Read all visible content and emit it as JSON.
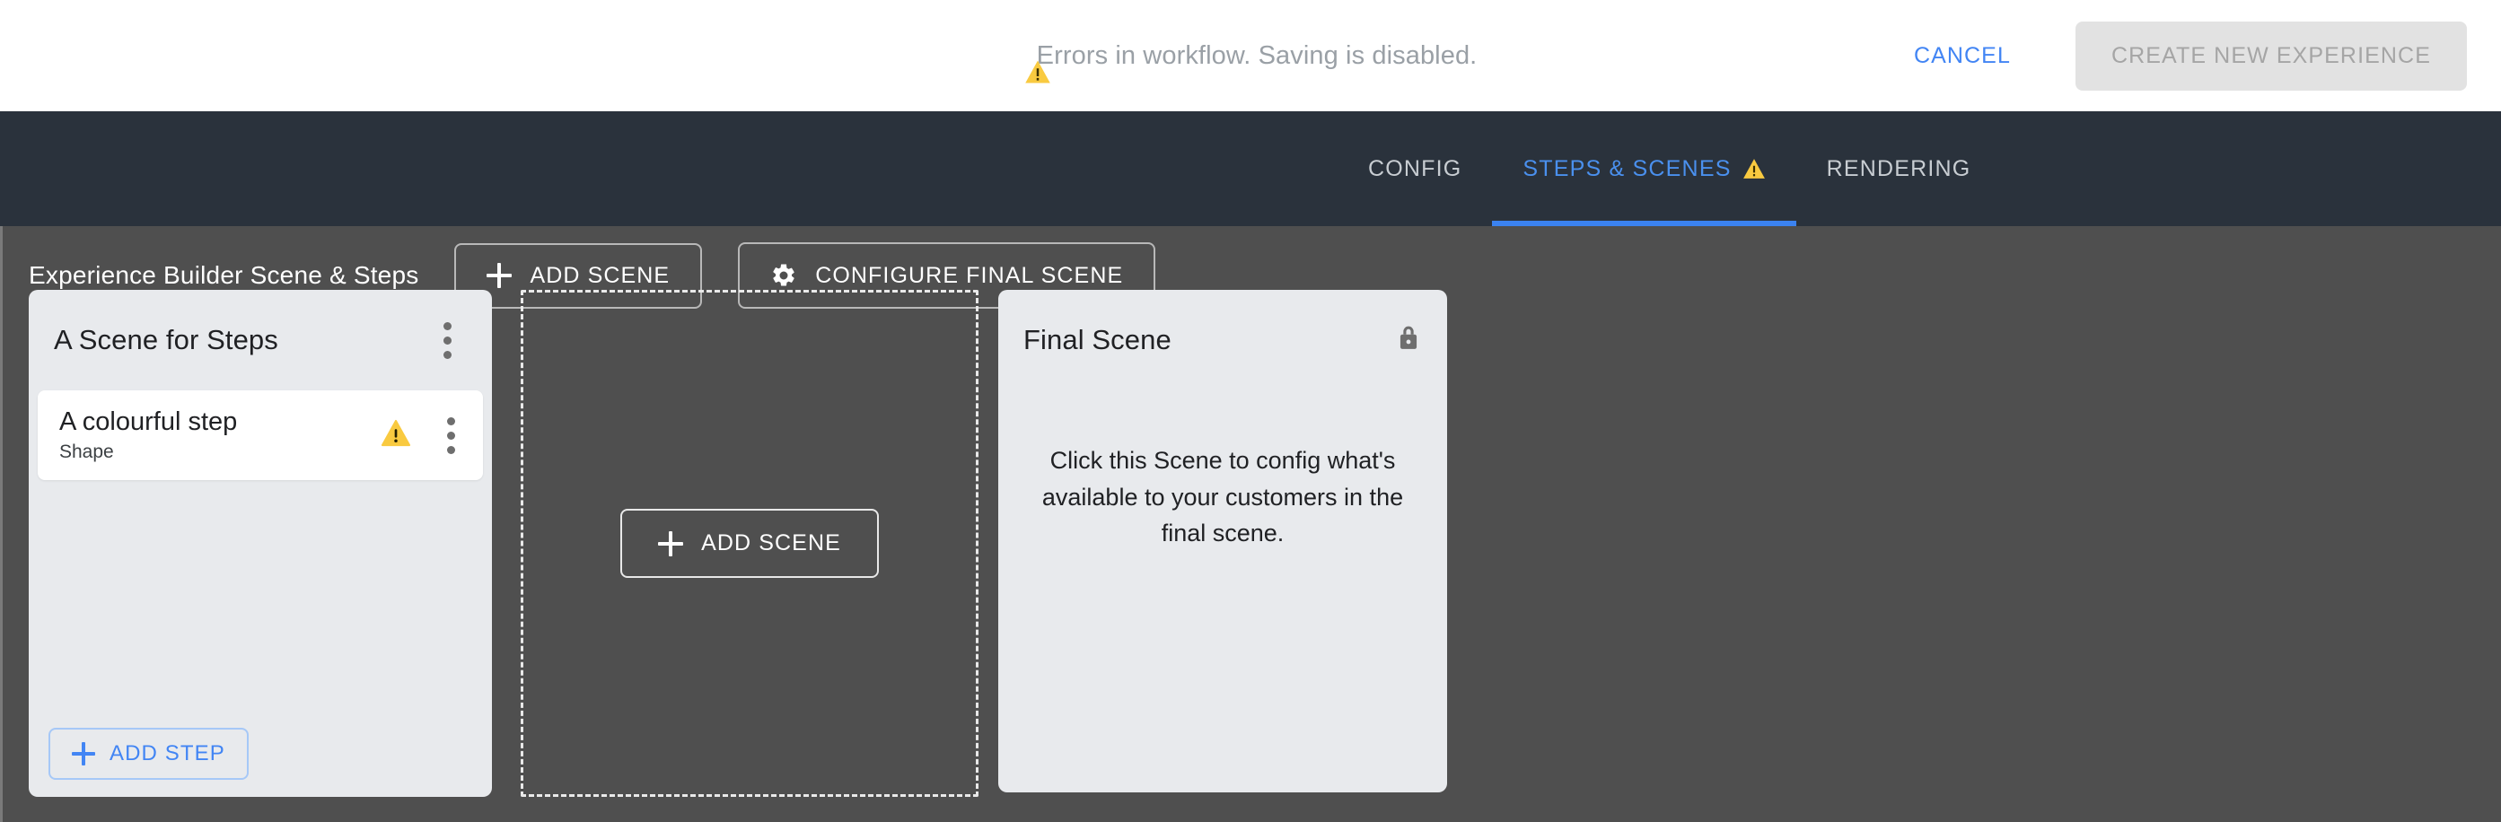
{
  "topbar": {
    "warning_icon": "warning-triangle-icon",
    "message": "Errors in workflow. Saving is disabled.",
    "cancel_label": "CANCEL",
    "create_label": "CREATE NEW EXPERIENCE"
  },
  "navbar": {
    "tabs": [
      {
        "label": "CONFIG",
        "active": false,
        "has_warning": false
      },
      {
        "label": "STEPS & SCENES",
        "active": true,
        "has_warning": true
      },
      {
        "label": "RENDERING",
        "active": false,
        "has_warning": false
      }
    ]
  },
  "toolbar": {
    "title": "Experience Builder Scene & Steps",
    "add_scene_label": "ADD SCENE",
    "configure_final_scene_label": "CONFIGURE FINAL SCENE",
    "add_scene_icon": "plus-icon",
    "configure_icon": "gear-icon"
  },
  "scenes": [
    {
      "title": "A Scene for Steps",
      "menu_icon": "kebab-menu-icon",
      "steps": [
        {
          "name": "A colourful step",
          "type": "Shape",
          "warning_icon": "warning-triangle-icon",
          "menu_icon": "kebab-menu-icon"
        }
      ],
      "add_step_label": "ADD STEP"
    }
  ],
  "dropzone": {
    "add_scene_label": "ADD SCENE",
    "add_scene_icon": "plus-icon"
  },
  "final_scene": {
    "title": "Final Scene",
    "lock_icon": "lock-icon",
    "hint": "Click this Scene to config what's available to your customers in the final scene."
  },
  "colors": {
    "accent_blue": "#4285f4",
    "tab_active_blue": "#4a90ee",
    "tab_underline": "#3b82f0",
    "warning_yellow": "#f9ca40",
    "navbar_bg": "#2a323c",
    "canvas_bg": "#4f4f4f",
    "card_bg": "#e8eaed",
    "step_bg": "#ffffff",
    "disabled_btn_bg": "#e2e2e2",
    "disabled_btn_text": "#a5a5a5",
    "muted_text": "#9aa0a6"
  }
}
